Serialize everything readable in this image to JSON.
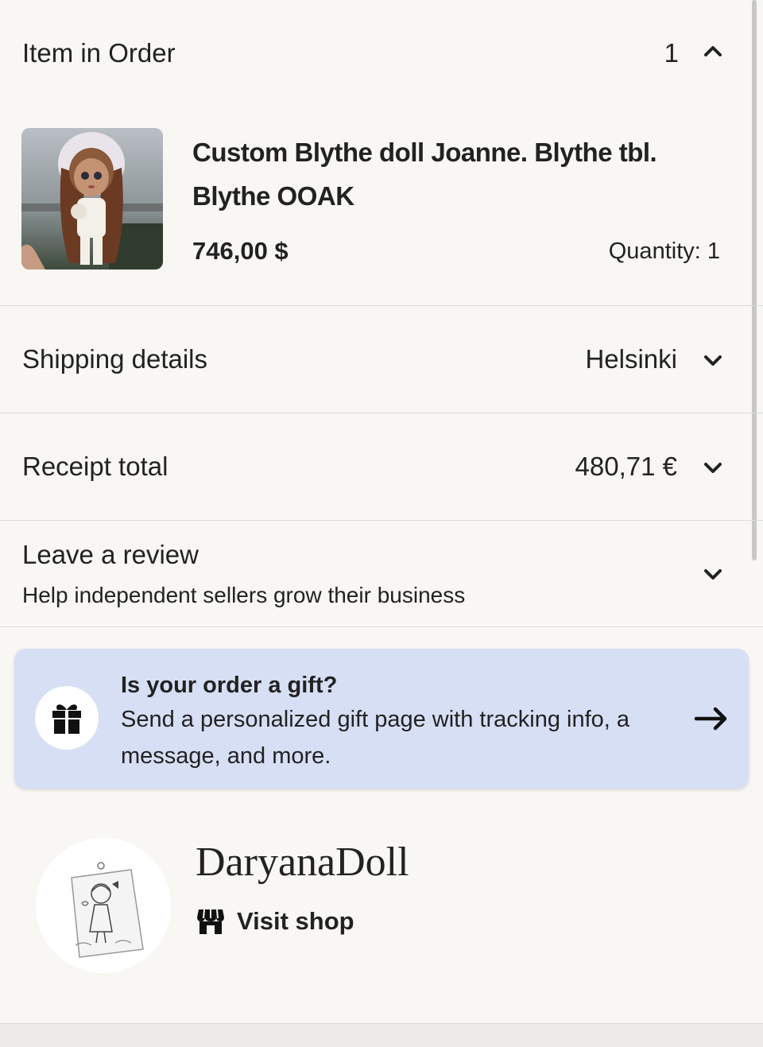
{
  "order_header": {
    "label": "Item in Order",
    "count": "1",
    "chevron": "chevron-up-icon"
  },
  "item": {
    "title": "Custom Blythe doll Joanne. Blythe tbl. Blythe OOAK",
    "price": "746,00 $",
    "quantity": "Quantity: 1",
    "image": "doll-photo"
  },
  "shipping": {
    "label": "Shipping details",
    "value": "Helsinki",
    "chevron": "chevron-down-icon"
  },
  "receipt": {
    "label": "Receipt total",
    "value": "480,71 €",
    "chevron": "chevron-down-icon"
  },
  "review": {
    "label": "Leave a review",
    "subtitle": "Help independent sellers grow their business",
    "chevron": "chevron-down-icon"
  },
  "gift": {
    "title": "Is your order a gift?",
    "text": "Send a personalized gift page with tracking info, a message, and more.",
    "icon": "gift-icon",
    "arrow": "arrow-right-icon",
    "background": "#d7dff5"
  },
  "shop": {
    "name": "DaryanaDoll",
    "visit_label": "Visit shop",
    "icon": "store-icon"
  }
}
